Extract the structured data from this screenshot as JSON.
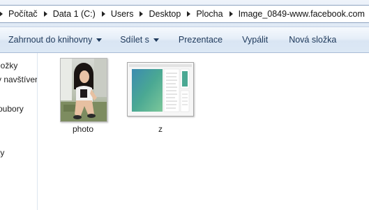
{
  "breadcrumb": {
    "items": [
      "Počítač",
      "Data 1 (C:)",
      "Users",
      "Desktop",
      "Plocha",
      "Image_0849-www.facebook.com"
    ]
  },
  "toolbar": {
    "organize_label": "Zahrnout do knihovny",
    "share_label": "Sdílet s",
    "slideshow_label": "Prezentace",
    "burn_label": "Vypálit",
    "new_folder_label": "Nová složka"
  },
  "nav": {
    "items": [
      "ložky",
      "y navštíver",
      "oubory",
      "ty"
    ]
  },
  "files": [
    {
      "name": "photo",
      "icon": "image-thumbnail"
    },
    {
      "name": "z",
      "icon": "window-thumbnail"
    }
  ],
  "colors": {
    "toolbar_text": "#1e395b",
    "toolbar_bg": "#dce8f5",
    "address_border": "#8ea4c1"
  }
}
